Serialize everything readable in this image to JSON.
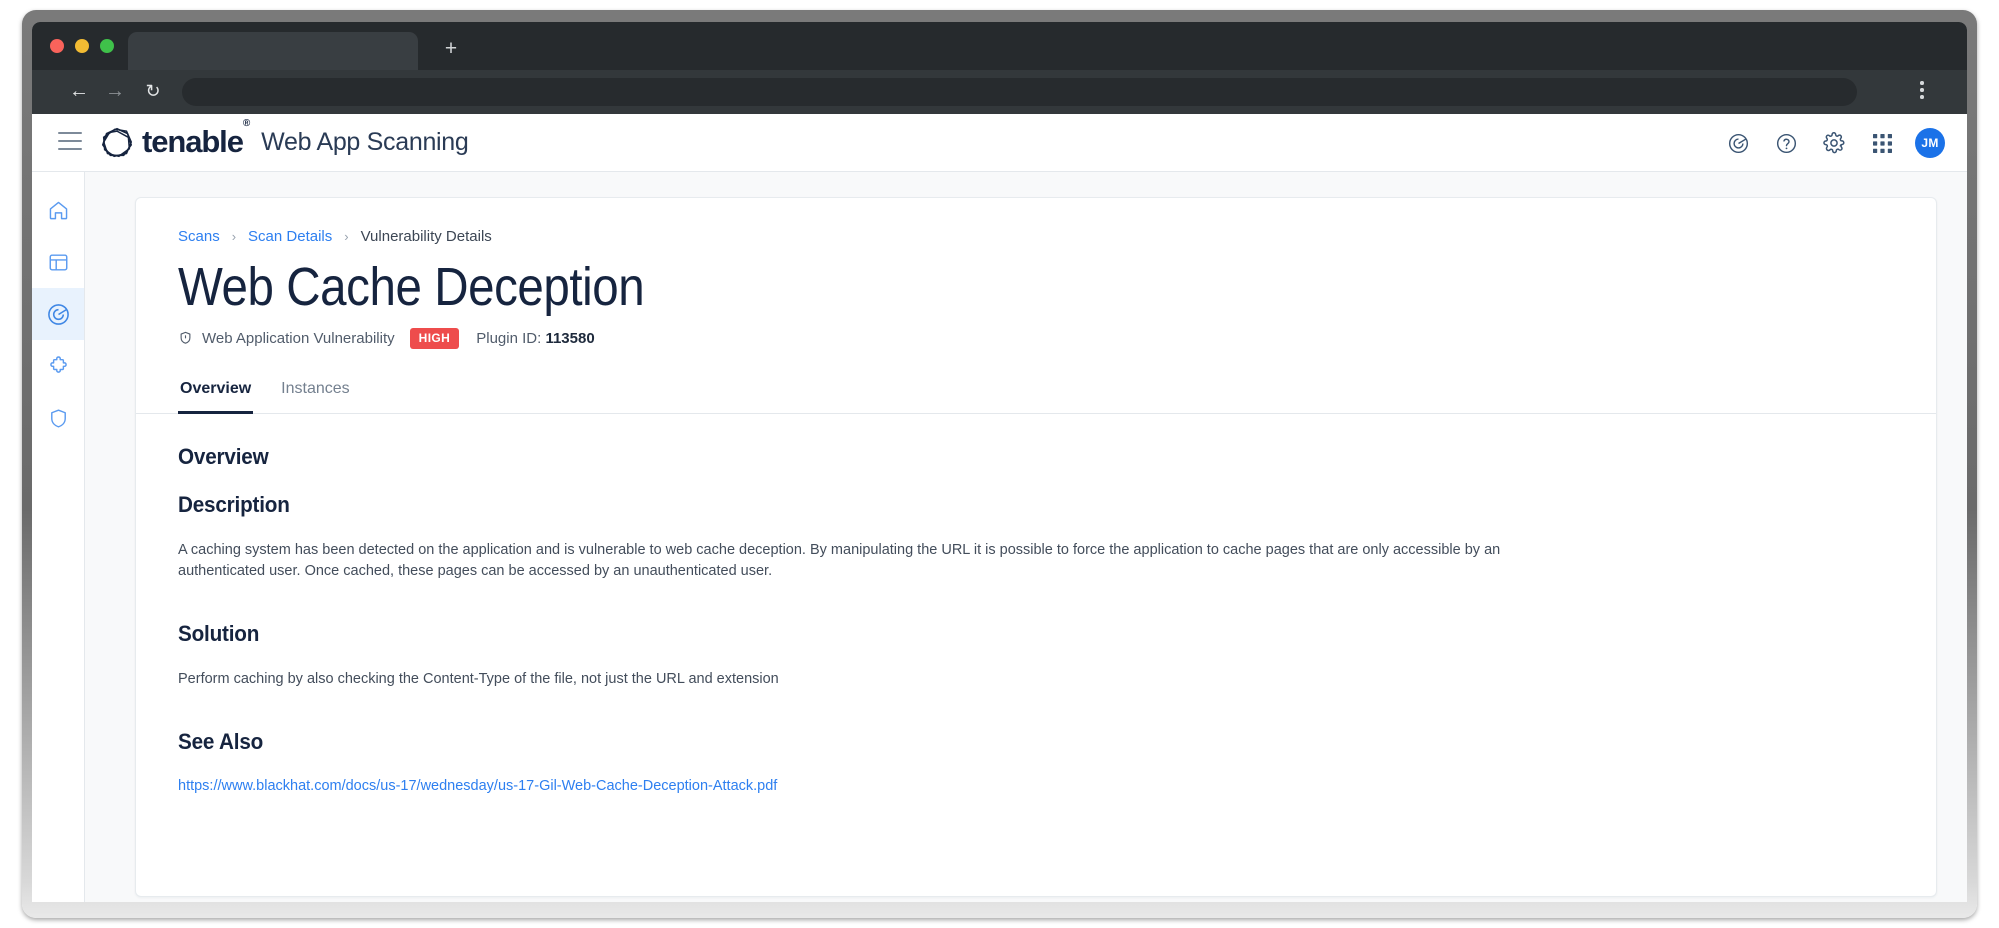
{
  "browser": {
    "tab_title": "",
    "new_tab_label": "+",
    "back_icon": "arrow-left-icon",
    "forward_icon": "arrow-right-icon",
    "reload_icon": "reload-icon",
    "address_value": "",
    "menu_icon": "kebab-menu-icon"
  },
  "header": {
    "menu_icon": "hamburger-icon",
    "brand": "tenable",
    "brand_trademark": "®",
    "product": "Web App Scanning",
    "actions": [
      {
        "name": "scan-radar-icon",
        "label": "Scans"
      },
      {
        "name": "help-icon",
        "label": "Help"
      },
      {
        "name": "gear-icon",
        "label": "Settings"
      },
      {
        "name": "apps-grid-icon",
        "label": "Apps"
      }
    ],
    "avatar_initials": "JM"
  },
  "sidebar": {
    "items": [
      {
        "name": "sidebar-item-home",
        "icon": "home-icon",
        "active": false
      },
      {
        "name": "sidebar-item-dashboards",
        "icon": "dashboard-icon",
        "active": false
      },
      {
        "name": "sidebar-item-scans",
        "icon": "scan-radar-icon",
        "active": true
      },
      {
        "name": "sidebar-item-findings",
        "icon": "puzzle-icon",
        "active": false
      },
      {
        "name": "sidebar-item-security",
        "icon": "shield-icon",
        "active": false
      }
    ]
  },
  "breadcrumb": {
    "scans": "Scans",
    "scan_details": "Scan Details",
    "current": "Vulnerability Details",
    "separator": "›"
  },
  "page": {
    "title": "Web Cache Deception",
    "type_label": "Web Application Vulnerability",
    "severity": "HIGH",
    "severity_color": "#ee4c4c",
    "plugin_id_label": "Plugin ID:",
    "plugin_id_value": "113580"
  },
  "tabs": [
    {
      "label": "Overview",
      "active": true
    },
    {
      "label": "Instances",
      "active": false
    }
  ],
  "sections": {
    "overview_heading": "Overview",
    "description_heading": "Description",
    "description_text": "A caching system has been detected on the application and is vulnerable to web cache deception. By manipulating the URL it is possible to force the application to cache pages that are only accessible by an authenticated user. Once cached, these pages can be accessed by an unauthenticated user.",
    "solution_heading": "Solution",
    "solution_text": "Perform caching by also checking the Content-Type of the file, not just the URL and extension",
    "see_also_heading": "See Also",
    "see_also_link": "https://www.blackhat.com/docs/us-17/wednesday/us-17-Gil-Web-Cache-Deception-Attack.pdf"
  },
  "colors": {
    "brand_navy": "#16243f",
    "link_blue": "#2d7ff0",
    "accent_blue": "#1b72e8",
    "sidebar_icon": "#5b9bf0"
  }
}
